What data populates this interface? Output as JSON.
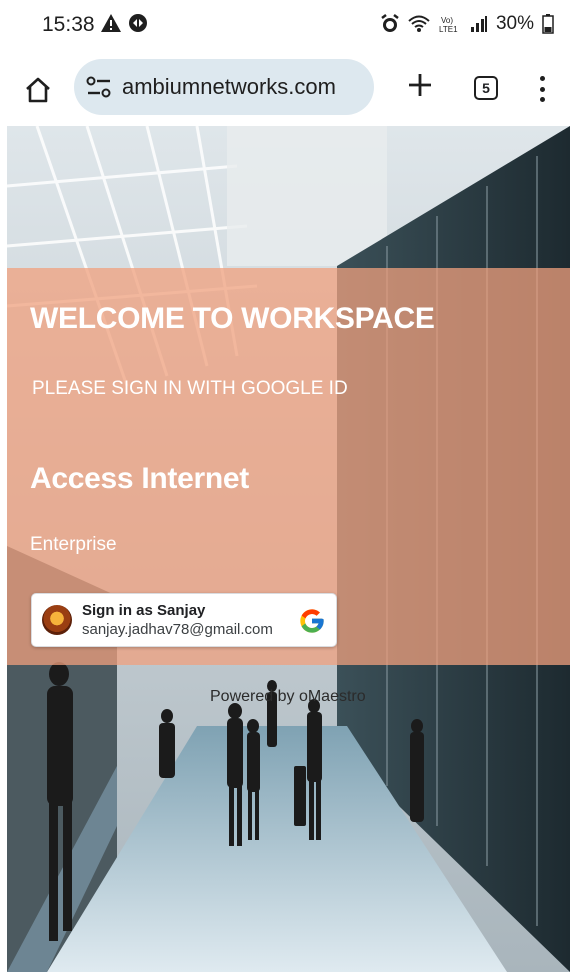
{
  "status_bar": {
    "time": "15:38",
    "battery": "30%",
    "icons": [
      "alert-icon",
      "vpn-icon",
      "alarm-icon",
      "wifi-icon",
      "volte-icon",
      "signal-icon",
      "battery-icon"
    ]
  },
  "browser": {
    "url": "ambiumnetworks.com",
    "tab_count": "5",
    "icons": [
      "home-icon",
      "site-info-icon",
      "new-tab-icon",
      "tab-switcher-icon",
      "more-menu-icon"
    ]
  },
  "page": {
    "welcome_title": "WELCOME TO WORKSPACE",
    "subtitle": "PLEASE SIGN IN WITH GOOGLE ID",
    "access_title": "Access Internet",
    "enterprise_label": "Enterprise",
    "google_signin": {
      "name_label": "Sign in as Sanjay",
      "email": "sanjay.jadhav78@gmail.com"
    },
    "powered_by": "Powered by  oMaestro",
    "overlay_color": "#f0a07d"
  }
}
